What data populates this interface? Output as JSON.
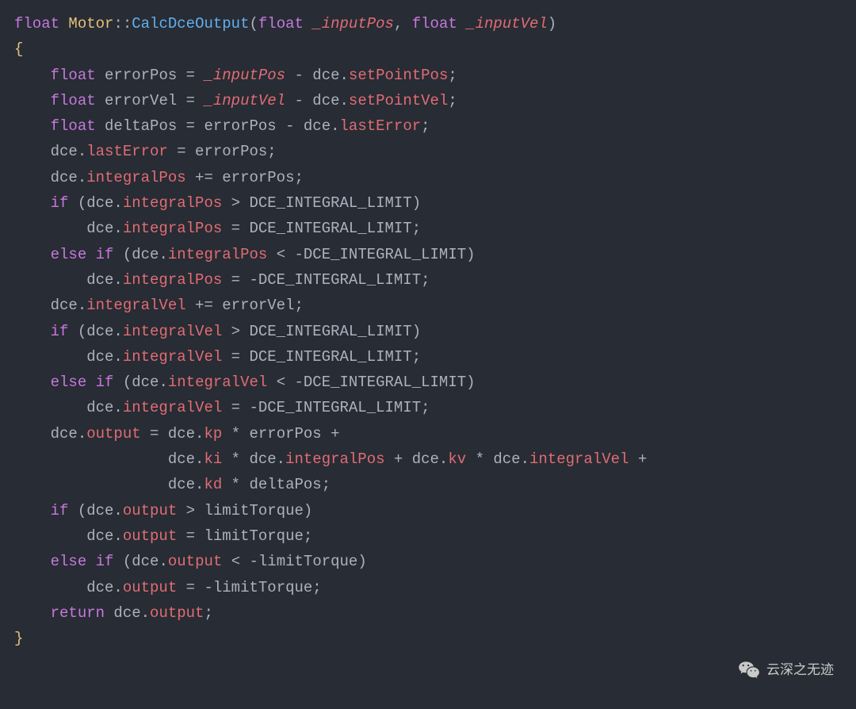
{
  "code": {
    "l1": {
      "float": "float",
      "sp": " ",
      "cls": "Motor",
      "scope": "::",
      "fn": "CalcDceOutput",
      "lp": "(",
      "t1": "float",
      "sp2": " ",
      "p1": "_inputPos",
      "c": ", ",
      "t2": "float",
      "sp3": " ",
      "p2": "_inputVel",
      "rp": ")"
    },
    "l2": {
      "brace": "{"
    },
    "l3": {
      "ind": "    ",
      "float": "float",
      "sp": " ",
      "v": "errorPos ",
      "op": "=",
      "sp2": " ",
      "p": "_inputPos",
      "sp3": " ",
      "op2": "-",
      "sp4": " dce.",
      "prop": "setPointPos",
      ";": ";"
    },
    "l4": {
      "ind": "    ",
      "float": "float",
      "sp": " ",
      "v": "errorVel ",
      "op": "=",
      "sp2": " ",
      "p": "_inputVel",
      "sp3": " ",
      "op2": "-",
      "sp4": " dce.",
      "prop": "setPointVel",
      ";": ";"
    },
    "l5": {
      "ind": "    ",
      "float": "float",
      "sp": " ",
      "v": "deltaPos ",
      "op": "=",
      "sp2": " errorPos ",
      "op2": "-",
      "sp3": " dce.",
      "prop": "lastError",
      ";": ";"
    },
    "l6": {
      "ind": "    dce.",
      "prop": "lastError",
      "sp": " ",
      "op": "=",
      "sp2": " errorPos;"
    },
    "l7": {
      "ind": "    dce.",
      "prop": "integralPos",
      "sp": " ",
      "op": "+=",
      "sp2": " errorPos;"
    },
    "l8": {
      "ind": "    ",
      "if": "if",
      "sp": " (dce.",
      "prop": "integralPos",
      "sp2": " ",
      "op": ">",
      "sp3": " DCE_INTEGRAL_LIMIT)"
    },
    "l9": {
      "ind": "        dce.",
      "prop": "integralPos",
      "sp": " ",
      "op": "=",
      "sp2": " DCE_INTEGRAL_LIMIT;"
    },
    "l10": {
      "ind": "    ",
      "else": "else",
      "sp": " ",
      "if": "if",
      "sp2": " (dce.",
      "prop": "integralPos",
      "sp3": " ",
      "op": "<",
      "sp4": " ",
      "op2": "-",
      "c": "DCE_INTEGRAL_LIMIT)"
    },
    "l11": {
      "ind": "        dce.",
      "prop": "integralPos",
      "sp": " ",
      "op": "=",
      "sp2": " ",
      "op2": "-",
      "c": "DCE_INTEGRAL_LIMIT;"
    },
    "l12": {
      "ind": "    dce.",
      "prop": "integralVel",
      "sp": " ",
      "op": "+=",
      "sp2": " errorVel;"
    },
    "l13": {
      "ind": "    ",
      "if": "if",
      "sp": " (dce.",
      "prop": "integralVel",
      "sp2": " ",
      "op": ">",
      "sp3": " DCE_INTEGRAL_LIMIT)"
    },
    "l14": {
      "ind": "        dce.",
      "prop": "integralVel",
      "sp": " ",
      "op": "=",
      "sp2": " DCE_INTEGRAL_LIMIT;"
    },
    "l15": {
      "ind": "    ",
      "else": "else",
      "sp": " ",
      "if": "if",
      "sp2": " (dce.",
      "prop": "integralVel",
      "sp3": " ",
      "op": "<",
      "sp4": " ",
      "op2": "-",
      "c": "DCE_INTEGRAL_LIMIT)"
    },
    "l16": {
      "ind": "        dce.",
      "prop": "integralVel",
      "sp": " ",
      "op": "=",
      "sp2": " ",
      "op2": "-",
      "c": "DCE_INTEGRAL_LIMIT;"
    },
    "l17": {
      "ind": "    dce.",
      "prop": "output",
      "sp": " ",
      "op": "=",
      "sp2": " dce.",
      "prop2": "kp",
      "sp3": " ",
      "op2": "*",
      "sp4": " errorPos ",
      "op3": "+"
    },
    "l18": {
      "ind": "                 dce.",
      "prop": "ki",
      "sp": " ",
      "op": "*",
      "sp2": " dce.",
      "prop2": "integralPos",
      "sp3": " ",
      "op2": "+",
      "sp4": " dce.",
      "prop3": "kv",
      "sp5": " ",
      "op3": "*",
      "sp6": " dce.",
      "prop4": "integralVel",
      "sp7": " ",
      "op4": "+"
    },
    "l19": {
      "ind": "                 dce.",
      "prop": "kd",
      "sp": " ",
      "op": "*",
      "sp2": " deltaPos;"
    },
    "l20": {
      "ind": "    ",
      "if": "if",
      "sp": " (dce.",
      "prop": "output",
      "sp2": " ",
      "op": ">",
      "sp3": " limitTorque)"
    },
    "l21": {
      "ind": "        dce.",
      "prop": "output",
      "sp": " ",
      "op": "=",
      "sp2": " limitTorque;"
    },
    "l22": {
      "ind": "    ",
      "else": "else",
      "sp": " ",
      "if": "if",
      "sp2": " (dce.",
      "prop": "output",
      "sp3": " ",
      "op": "<",
      "sp4": " ",
      "op2": "-",
      "c": "limitTorque)"
    },
    "l23": {
      "ind": "        dce.",
      "prop": "output",
      "sp": " ",
      "op": "=",
      "sp2": " ",
      "op2": "-",
      "c": "limitTorque;"
    },
    "l24": {
      "ind": "    ",
      "return": "return",
      "sp": " dce.",
      "prop": "output",
      ";": ";"
    },
    "l25": {
      "brace": "}"
    }
  },
  "watermark": "云深之无迹"
}
